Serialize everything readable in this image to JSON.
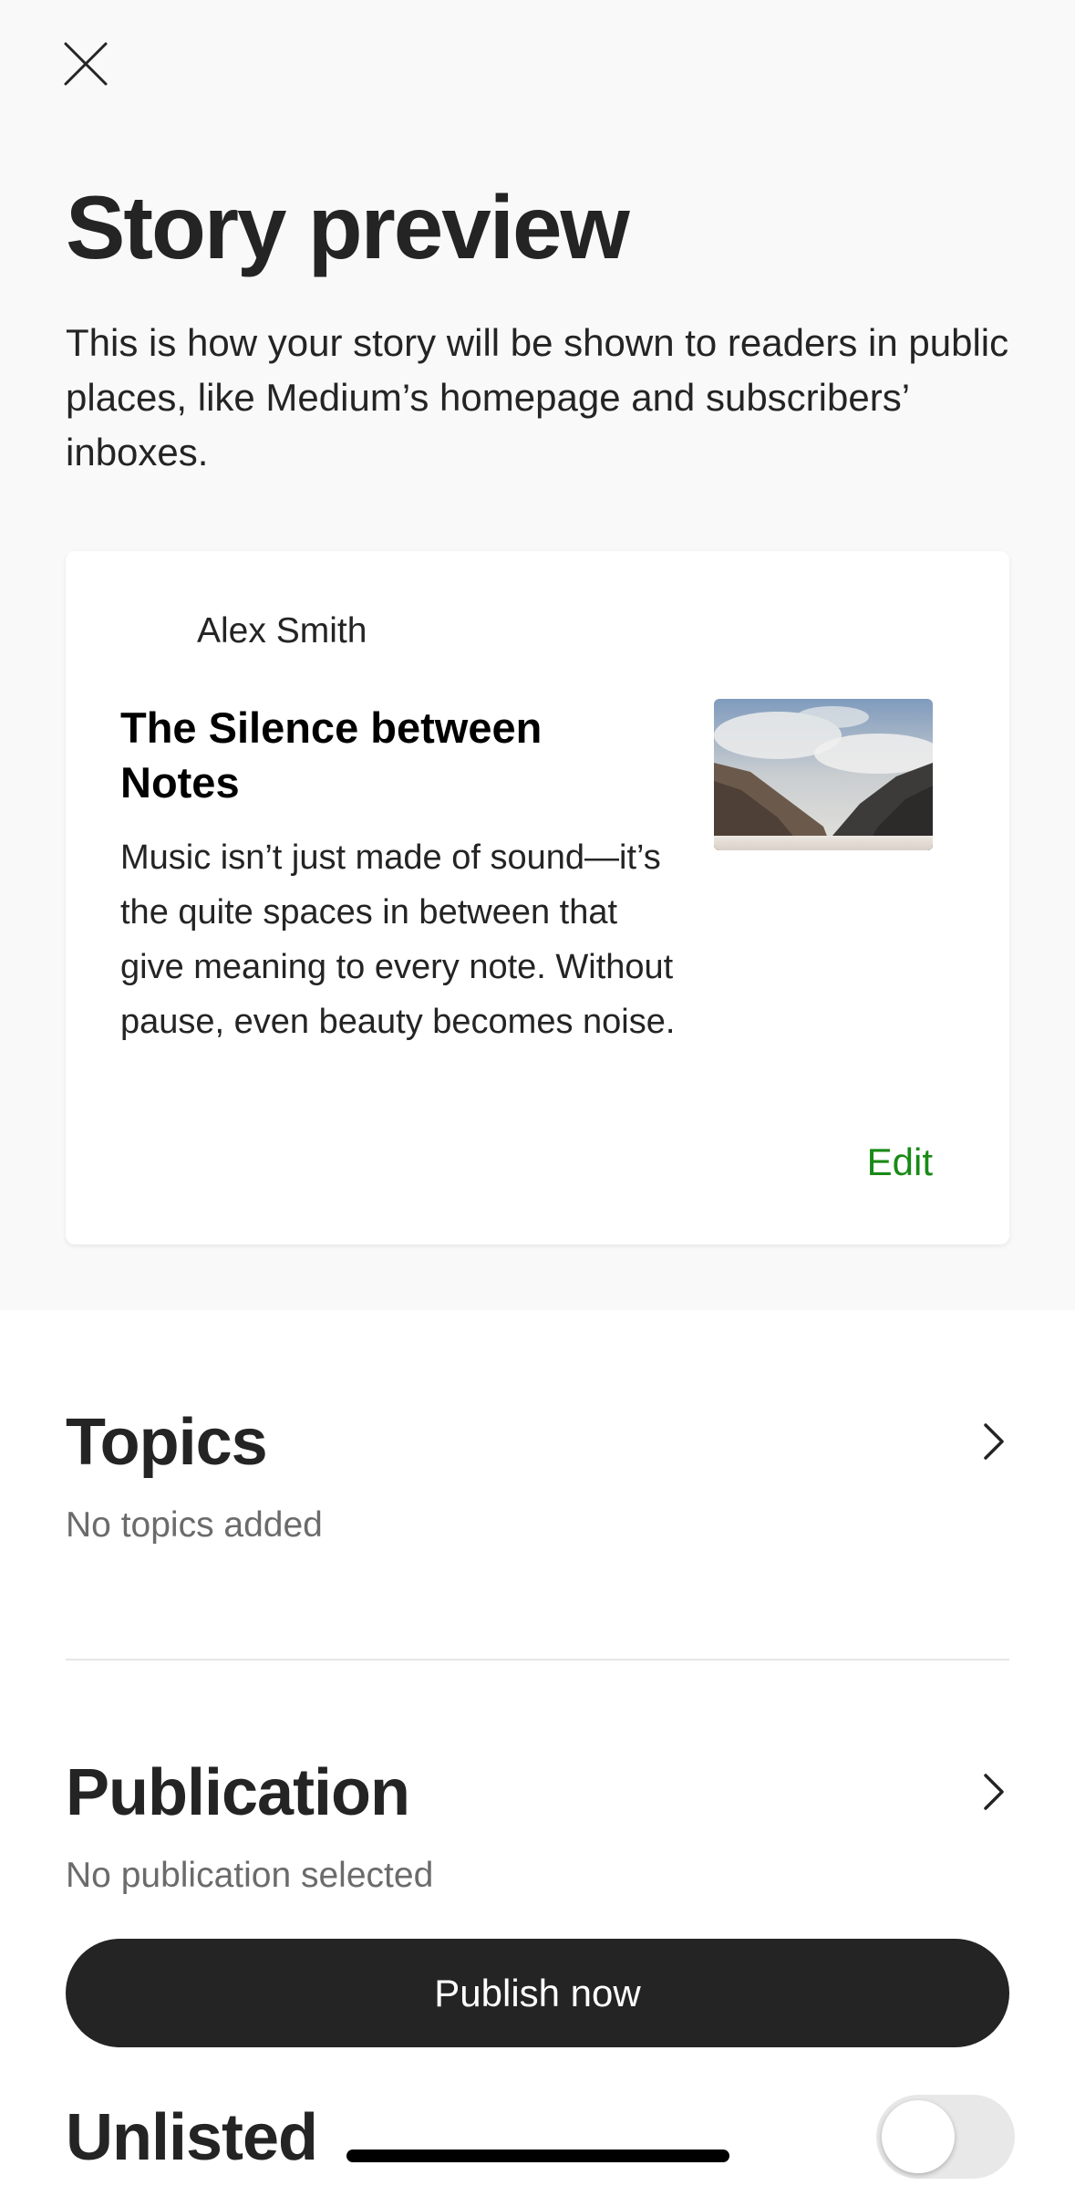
{
  "header": {
    "close_icon": "close-icon",
    "title": "Story preview",
    "description": "This is how your story will be shown to readers in public places, like Medium’s homepage and subscribers’ inboxes."
  },
  "preview_card": {
    "author": "Alex Smith",
    "title": "The Silence between Notes",
    "excerpt": "Music isn’t just made of sound—it’s the quite spaces in between that give meaning to every note. Without pause, even beauty becomes noise.",
    "thumbnail": "mountain-landscape-image",
    "edit_label": "Edit"
  },
  "topics": {
    "title": "Topics",
    "subtitle": "No topics added",
    "icon": "chevron-right-icon"
  },
  "publication": {
    "title": "Publication",
    "subtitle": "No publication selected",
    "icon": "chevron-right-icon"
  },
  "publish_button": {
    "label": "Publish now"
  },
  "unlisted": {
    "title": "Unlisted",
    "toggle_on": false
  },
  "colors": {
    "accent_green": "#1a8917",
    "button_dark": "#242424",
    "background_gray": "#f9f9f9"
  }
}
